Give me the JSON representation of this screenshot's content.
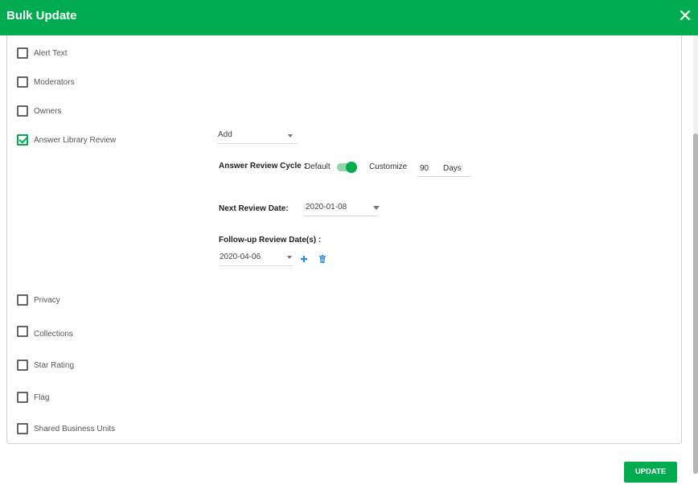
{
  "header": {
    "title": "Bulk Update"
  },
  "options": {
    "alert_text": {
      "label": "Alert Text",
      "checked": false
    },
    "moderators": {
      "label": "Moderators",
      "checked": false
    },
    "owners": {
      "label": "Owners",
      "checked": false
    },
    "answer_library_review": {
      "label": "Answer Library Review",
      "checked": true
    },
    "privacy": {
      "label": "Privacy",
      "checked": false
    },
    "collections": {
      "label": "Collections",
      "checked": false
    },
    "star_rating": {
      "label": "Star Rating",
      "checked": false
    },
    "flag": {
      "label": "Flag",
      "checked": false
    },
    "shared_business_units": {
      "label": "Shared Business Units",
      "checked": false
    }
  },
  "review": {
    "action": "Add",
    "cycle_label": "Answer Review Cycle :",
    "default_label": "Default",
    "toggle_on": true,
    "customize_label": "Customize",
    "customize_value": "90",
    "days_label": "Days",
    "next_date_label": "Next Review Date:",
    "next_date": "2020-01-08",
    "followup_label": "Follow-up Review Date(s) :",
    "followup_date": "2020-04-06"
  },
  "footer": {
    "update_label": "UPDATE"
  },
  "colors": {
    "accent": "#00ac4f",
    "accent_light": "#8fd6ad",
    "icon_blue": "#2b8fd9"
  }
}
